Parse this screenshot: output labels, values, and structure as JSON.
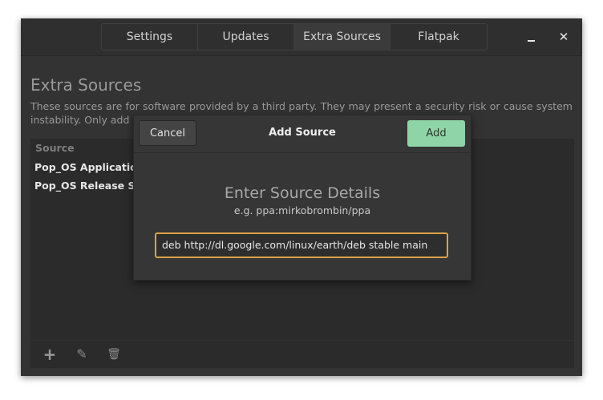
{
  "tabs": [
    {
      "label": "Settings"
    },
    {
      "label": "Updates"
    },
    {
      "label": "Extra Sources"
    },
    {
      "label": "Flatpak"
    }
  ],
  "window_controls": {
    "minimize": "minimize-icon",
    "close_glyph": "✕"
  },
  "page": {
    "title": "Extra Sources",
    "description": "These sources are for software provided by a third party. They may present a security risk or cause system instability. Only add"
  },
  "list": {
    "header": "Source",
    "items": [
      {
        "label": "Pop_OS Applications"
      },
      {
        "label": "Pop_OS Release Sou"
      }
    ]
  },
  "toolbar": {
    "add_glyph": "+",
    "edit_glyph": "✎",
    "delete_glyph": "🗑"
  },
  "dialog": {
    "title": "Add Source",
    "cancel_label": "Cancel",
    "add_label": "Add",
    "heading": "Enter Source Details",
    "example": "e.g. ppa:mirkobrombin/ppa",
    "input_value": "deb http://dl.google.com/linux/earth/deb stable main"
  },
  "colors": {
    "accent_add": "#8fd4a7",
    "input_focus": "#d9a24a",
    "window_bg": "#333333"
  }
}
